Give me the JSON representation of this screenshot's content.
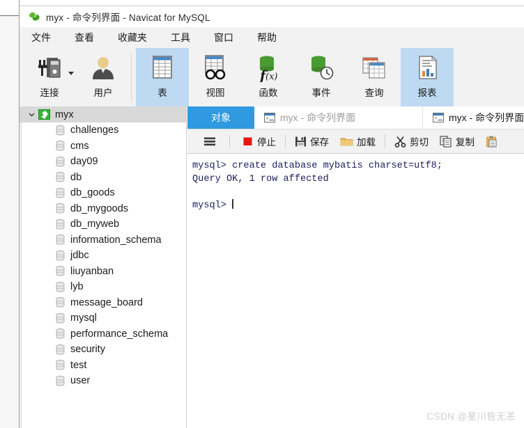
{
  "window": {
    "title": "myx - 命令列界面 - Navicat for MySQL",
    "logo_icon": "navicat-logo-icon"
  },
  "menubar": {
    "items": [
      {
        "label": "文件",
        "name": "menu-file"
      },
      {
        "label": "查看",
        "name": "menu-view"
      },
      {
        "label": "收藏夹",
        "name": "menu-favorites"
      },
      {
        "label": "工具",
        "name": "menu-tools"
      },
      {
        "label": "窗口",
        "name": "menu-window"
      },
      {
        "label": "帮助",
        "name": "menu-help"
      }
    ]
  },
  "ribbon": {
    "buttons": [
      {
        "label": "连接",
        "icon": "connection-icon",
        "selected": false,
        "dropdown": true
      },
      {
        "label": "用户",
        "icon": "user-icon",
        "selected": false,
        "dropdown": false
      },
      {
        "label": "表",
        "icon": "table-icon",
        "selected": true,
        "dropdown": false
      },
      {
        "label": "视图",
        "icon": "view-icon",
        "selected": false,
        "dropdown": false
      },
      {
        "label": "函数",
        "icon": "function-icon",
        "selected": false,
        "dropdown": false
      },
      {
        "label": "事件",
        "icon": "event-icon",
        "selected": false,
        "dropdown": false
      },
      {
        "label": "查询",
        "icon": "query-icon",
        "selected": false,
        "dropdown": false
      },
      {
        "label": "报表",
        "icon": "report-icon",
        "selected": true,
        "dropdown": false
      }
    ]
  },
  "sidebar": {
    "root": {
      "label": "myx",
      "icon": "navicat-connection-icon",
      "expanded": true
    },
    "databases": [
      "challenges",
      "cms",
      "day09",
      "db",
      "db_goods",
      "db_mygoods",
      "db_myweb",
      "information_schema",
      "jdbc",
      "liuyanban",
      "lyb",
      "message_board",
      "mysql",
      "performance_schema",
      "security",
      "test",
      "user"
    ]
  },
  "tabs": [
    {
      "label": "对象",
      "name": "tab-objects",
      "state": "objects",
      "icon": null
    },
    {
      "label": "myx - 命令列界面",
      "name": "tab-command-line-1",
      "state": "inactive",
      "icon": "console-icon"
    },
    {
      "label": "myx - 命令列界面",
      "name": "tab-command-line-2",
      "state": "active",
      "icon": "console-icon"
    }
  ],
  "console_toolbar": {
    "buttons": [
      {
        "label": "",
        "icon": "hamburger-menu-icon",
        "name": "console-menu-button"
      },
      {
        "label": "停止",
        "icon": "stop-icon",
        "name": "stop-button"
      },
      {
        "label": "保存",
        "icon": "save-icon",
        "name": "save-button"
      },
      {
        "label": "加载",
        "icon": "load-folder-icon",
        "name": "load-button"
      },
      {
        "label": "剪切",
        "icon": "cut-scissors-icon",
        "name": "cut-button"
      },
      {
        "label": "复制",
        "icon": "copy-icon",
        "name": "copy-button"
      },
      {
        "label": "",
        "icon": "paste-clipboard-icon",
        "name": "paste-button"
      }
    ]
  },
  "terminal": {
    "lines": [
      "mysql> create database mybatis charset=utf8;",
      "Query OK, 1 row affected",
      "",
      "mysql> "
    ],
    "prompt_cursor": true
  },
  "watermark": {
    "text": "CSDN @星川皆无恙"
  },
  "colors": {
    "accent": "#2f9ae0",
    "ribbon_selected": "#bed9f2",
    "tree_root_selected": "#d8d8d8",
    "terminal_text": "#1d1d5e",
    "stop_red": "#e81717",
    "db_green": "#35b535"
  }
}
